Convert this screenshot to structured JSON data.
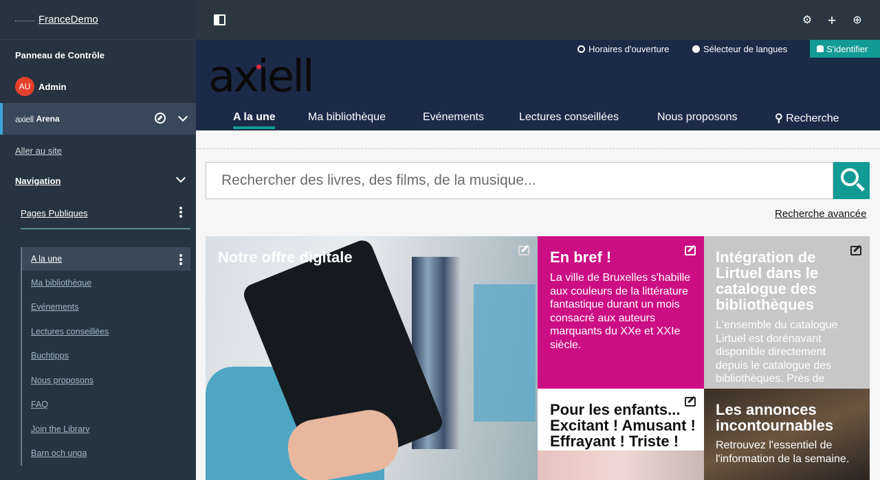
{
  "sidebar": {
    "brand": "FranceDemo",
    "control_panel": "Panneau de Contrôle",
    "user": {
      "initials": "AU",
      "name": "Admin"
    },
    "site": {
      "logo": "axiell",
      "name": "Arena"
    },
    "goto_site": "Aller au site",
    "navigation": "Navigation",
    "public_pages": "Pages Publiques",
    "pages": [
      "A la une",
      "Ma bibliothèque",
      "Evénements",
      "Lectures conseillées",
      "Buchtipps",
      "Nous proposons",
      "FAQ",
      "Join the Library",
      "Barn och unga"
    ],
    "active_page": "A la une"
  },
  "topbar": {
    "icons": [
      "panel-toggle-icon",
      "gear-icon",
      "plus-icon",
      "globe-icon"
    ]
  },
  "site_header": {
    "util_links": [
      "Horaires d'ouverture",
      "Sélecteur de langues"
    ],
    "login": "S'identifier",
    "logo_text": "axiell",
    "menu": [
      "A la une",
      "Ma bibliothèque",
      "Evénements",
      "Lectures conseillées",
      "Nous proposons",
      "Recherche"
    ],
    "active_menu": "A la une"
  },
  "search": {
    "placeholder": "Rechercher des livres, des films, de la musique...",
    "advanced": "Recherche avancée"
  },
  "tiles": {
    "digital": {
      "title": "Notre offre digitale"
    },
    "bref": {
      "title": "En bref !",
      "text": "La ville de Bruxelles s'habille aux couleurs de la littérature fantastique durant un mois consacré aux auteurs marquants du XXe et XXIe siècle."
    },
    "lirtuel": {
      "title": "Intégration de Lirtuel dans le catalogue des bibliothèques",
      "text": "L'ensemble du catalogue Lirtuel est dorénavant disponible directement depuis le catalogue des bibliothèques. Près de"
    },
    "enfants": {
      "title": "Pour les enfants... Excitant ! Amusant ! Effrayant ! Triste !"
    },
    "annonces": {
      "title": "Les annonces incontournables",
      "text": "Retrouvez l'essentiel de l'information de la semaine."
    }
  },
  "colors": {
    "sidebar_bg": "#263340",
    "header_bg": "#1b2a47",
    "teal": "#129a95",
    "magenta": "#cc0e83",
    "avatar": "#e53f2d"
  }
}
